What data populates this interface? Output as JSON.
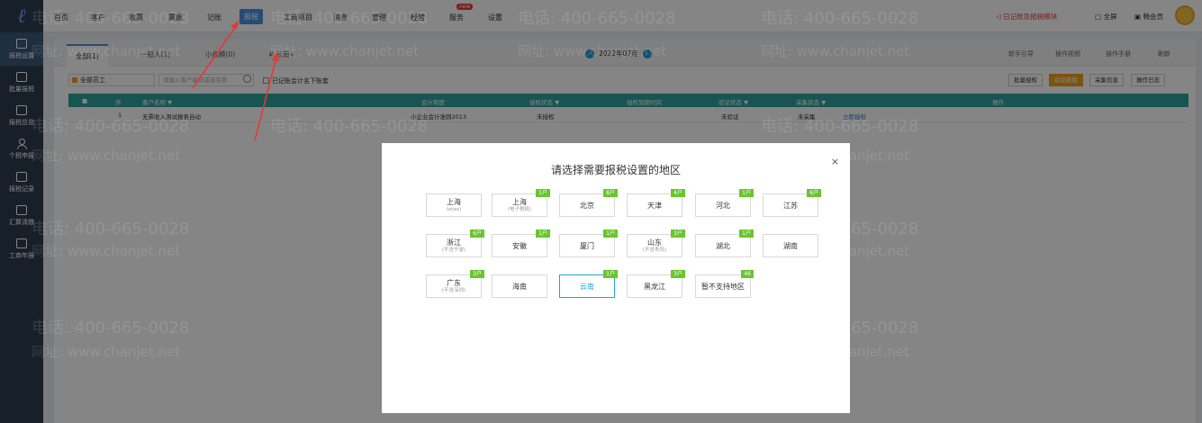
{
  "sidebar": {
    "logo_icon": "app-logo-icon",
    "items": [
      {
        "label": "报税设置",
        "icon": "monitor-icon",
        "active": true
      },
      {
        "label": "批量报税",
        "icon": "monitor-icon"
      },
      {
        "label": "报税总览",
        "icon": "monitor-icon"
      },
      {
        "label": "个税申报",
        "icon": "person-icon"
      },
      {
        "label": "报税记录",
        "icon": "clipboard-icon"
      },
      {
        "label": "汇算清缴",
        "icon": "chart-icon"
      },
      {
        "label": "工商年报",
        "icon": "calendar-icon"
      }
    ]
  },
  "topnav": {
    "items": [
      "首页",
      "客户",
      "收票",
      "票据",
      "记账",
      "报税",
      "工商项目",
      "消息",
      "管理",
      "经营",
      "服务",
      "设置"
    ],
    "active": "报税",
    "new_badge": "new",
    "notice": "日记账及报税模块",
    "fullscreen": "全屏",
    "member": "畅会员"
  },
  "tabs": {
    "items": [
      "全部(1)",
      "一般人(1)",
      "小规模(0)",
      "# 云南∨"
    ],
    "active_index": 0,
    "period": "2022年07月",
    "prev_icon": "chevron-left-icon",
    "next_icon": "chevron-right-icon",
    "right_links": [
      "新手引导",
      "操作视频",
      "操作手册",
      "刷新"
    ]
  },
  "filters": {
    "staff_select": "全部员工",
    "search_placeholder": "请输入客户编码或者名称",
    "checkbox_label": "已记账会计名下账套",
    "buttons": [
      "批量授权",
      "验证新版",
      "采集信息",
      "操作日志"
    ]
  },
  "table": {
    "headers": [
      "■",
      "序",
      "客户名称 ▼",
      "会计制度",
      "授权状态 ▼",
      "授权到期时间",
      "验证状态 ▼",
      "采集状态 ▼",
      "操作"
    ],
    "rows": [
      {
        "index": "1",
        "name": "无票收入测试报表自动",
        "system": "小企业会计准则2013",
        "auth": "未授权",
        "expire": "",
        "verify": "未验证",
        "collect": "未采集",
        "action": "立即授权"
      }
    ]
  },
  "modal": {
    "title": "请选择需要报税设置的地区",
    "close": "×",
    "regions": [
      {
        "name": "上海",
        "sub": "(etax)",
        "badge": ""
      },
      {
        "name": "上海",
        "sub": "(电子税局)",
        "badge": "1户"
      },
      {
        "name": "北京",
        "sub": "",
        "badge": "8户"
      },
      {
        "name": "天津",
        "sub": "",
        "badge": "4户"
      },
      {
        "name": "河北",
        "sub": "",
        "badge": "1户"
      },
      {
        "name": "江苏",
        "sub": "",
        "badge": "6户"
      },
      {
        "name": "浙江",
        "sub": "(不含宁波)",
        "badge": "6户"
      },
      {
        "name": "安徽",
        "sub": "",
        "badge": "1户"
      },
      {
        "name": "厦门",
        "sub": "",
        "badge": "1户"
      },
      {
        "name": "山东",
        "sub": "(不含青岛)",
        "badge": "3户"
      },
      {
        "name": "湖北",
        "sub": "",
        "badge": "1户"
      },
      {
        "name": "湖南",
        "sub": "",
        "badge": ""
      },
      {
        "name": "广东",
        "sub": "(不含深圳)",
        "badge": "3户"
      },
      {
        "name": "海南",
        "sub": "",
        "badge": ""
      },
      {
        "name": "云南",
        "sub": "",
        "badge": "1户",
        "selected": true
      },
      {
        "name": "黑龙江",
        "sub": "",
        "badge": "3户"
      },
      {
        "name": "暂不支持地区",
        "sub": "",
        "badge": "46"
      }
    ]
  },
  "watermark": {
    "phone": "电话: 400-665-0028",
    "site": "网址: www.chanjet.net"
  },
  "colors": {
    "accent": "#4a90e2",
    "table_head": "#2ea39e",
    "badge": "#6ac52f",
    "selected": "#1ea5d8",
    "arrow": "#e53935"
  }
}
